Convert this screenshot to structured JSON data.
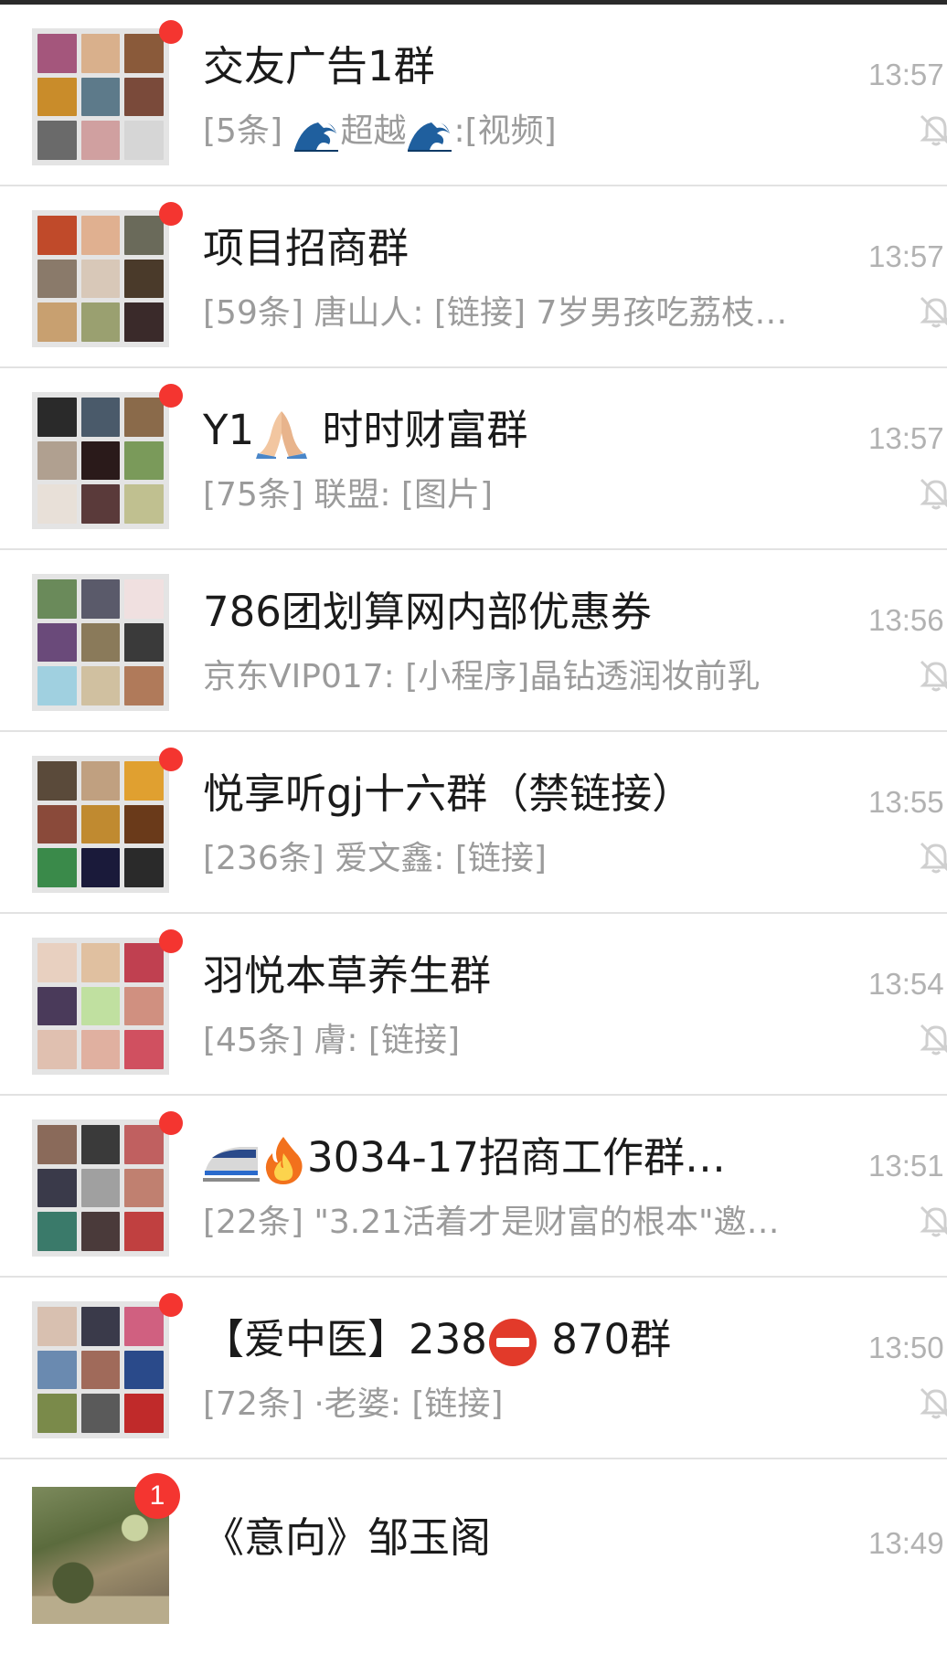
{
  "chats": [
    {
      "title_parts": [
        "交友广告1群"
      ],
      "preview_parts": [
        "[5条] ",
        {
          "emoji": "wave-emoji"
        },
        "超越",
        {
          "emoji": "wave-emoji"
        },
        ":[视频]"
      ],
      "time": "13:57",
      "unread_dot": true,
      "muted": true,
      "avatar_colors": [
        "#a4567c",
        "#d9b08c",
        "#8a5a3a",
        "#c98c2a",
        "#5d7a8a",
        "#7a4a3a",
        "#6a6a6a",
        "#d0a0a0",
        "#d6d6d6"
      ]
    },
    {
      "title_parts": [
        "项目招商群"
      ],
      "preview_parts": [
        "[59条] 唐山人: [链接] 7岁男孩吃荔枝…"
      ],
      "time": "13:57",
      "unread_dot": true,
      "muted": true,
      "avatar_colors": [
        "#c04a2a",
        "#e0b090",
        "#6a6a5a",
        "#8a7a6a",
        "#d8c8b8",
        "#4a3a2a",
        "#c8a070",
        "#9aa070",
        "#3a2a2a"
      ]
    },
    {
      "title_parts": [
        "Y1",
        {
          "emoji": "folded-hands-emoji"
        },
        " 时时财富群"
      ],
      "preview_parts": [
        "[75条] 联盟: [图片]"
      ],
      "time": "13:57",
      "unread_dot": true,
      "muted": true,
      "avatar_colors": [
        "#2a2a2a",
        "#4a5a6a",
        "#8a6a4a",
        "#b0a090",
        "#2a1a1a",
        "#7a9a5a",
        "#e8e0d8",
        "#5a3a3a",
        "#c0c090"
      ]
    },
    {
      "title_parts": [
        "786团划算网内部优惠券"
      ],
      "preview_parts": [
        "京东VIP017: [小程序]晶钻透润妆前乳"
      ],
      "time": "13:56",
      "unread_dot": false,
      "muted": true,
      "avatar_colors": [
        "#6a8a5a",
        "#5a5a6a",
        "#f0e0e0",
        "#6a4a7a",
        "#8a7a5a",
        "#3a3a3a",
        "#a0d0e0",
        "#d0c0a0",
        "#b07a5a"
      ]
    },
    {
      "title_parts": [
        "悦享听gj十六群（禁链接）"
      ],
      "preview_parts": [
        "[236条] 爱文鑫: [链接]"
      ],
      "time": "13:55",
      "unread_dot": true,
      "muted": true,
      "avatar_colors": [
        "#5a4a3a",
        "#c0a080",
        "#e0a030",
        "#8a4a3a",
        "#c08a30",
        "#6a3a1a",
        "#3a8a4a",
        "#1a1a3a",
        "#2a2a2a"
      ]
    },
    {
      "title_parts": [
        "羽悦本草养生群"
      ],
      "preview_parts": [
        "[45条] 膚: [链接]"
      ],
      "time": "13:54",
      "unread_dot": true,
      "muted": true,
      "avatar_colors": [
        "#e8d0c0",
        "#e0c0a0",
        "#c04050",
        "#4a3a5a",
        "#c0e0a0",
        "#d09080",
        "#e0c0b0",
        "#e0b0a0",
        "#d05060"
      ]
    },
    {
      "title_parts": [
        {
          "emoji": "bullet-train-emoji"
        },
        {
          "emoji": "fire-emoji"
        },
        "3034-17招商工作群…"
      ],
      "preview_parts": [
        "[22条] \"3.21活着才是财富的根本\"邀…"
      ],
      "time": "13:51",
      "unread_dot": true,
      "muted": true,
      "avatar_colors": [
        "#8a6a5a",
        "#3a3a3a",
        "#c06060",
        "#3a3a4a",
        "#a0a0a0",
        "#c08070",
        "#3a7a6a",
        "#4a3a3a",
        "#c04040"
      ]
    },
    {
      "title_parts": [
        "【爱中医】238",
        {
          "emoji": "no-entry-emoji"
        },
        " 870群"
      ],
      "preview_parts": [
        "[72条] ·老婆: [链接]"
      ],
      "time": "13:50",
      "unread_dot": true,
      "muted": true,
      "avatar_colors": [
        "#d8c0b0",
        "#3a3a4a",
        "#d06080",
        "#6a8ab0",
        "#a06a5a",
        "#2a4a8a",
        "#7a8a4a",
        "#5a5a5a",
        "#c02a2a"
      ]
    },
    {
      "title_parts": [
        "《意向》邹玉阁"
      ],
      "preview_parts": [],
      "time": "13:49",
      "unread_dot": false,
      "unread_count": "1",
      "muted": false,
      "avatar_colors": []
    }
  ]
}
